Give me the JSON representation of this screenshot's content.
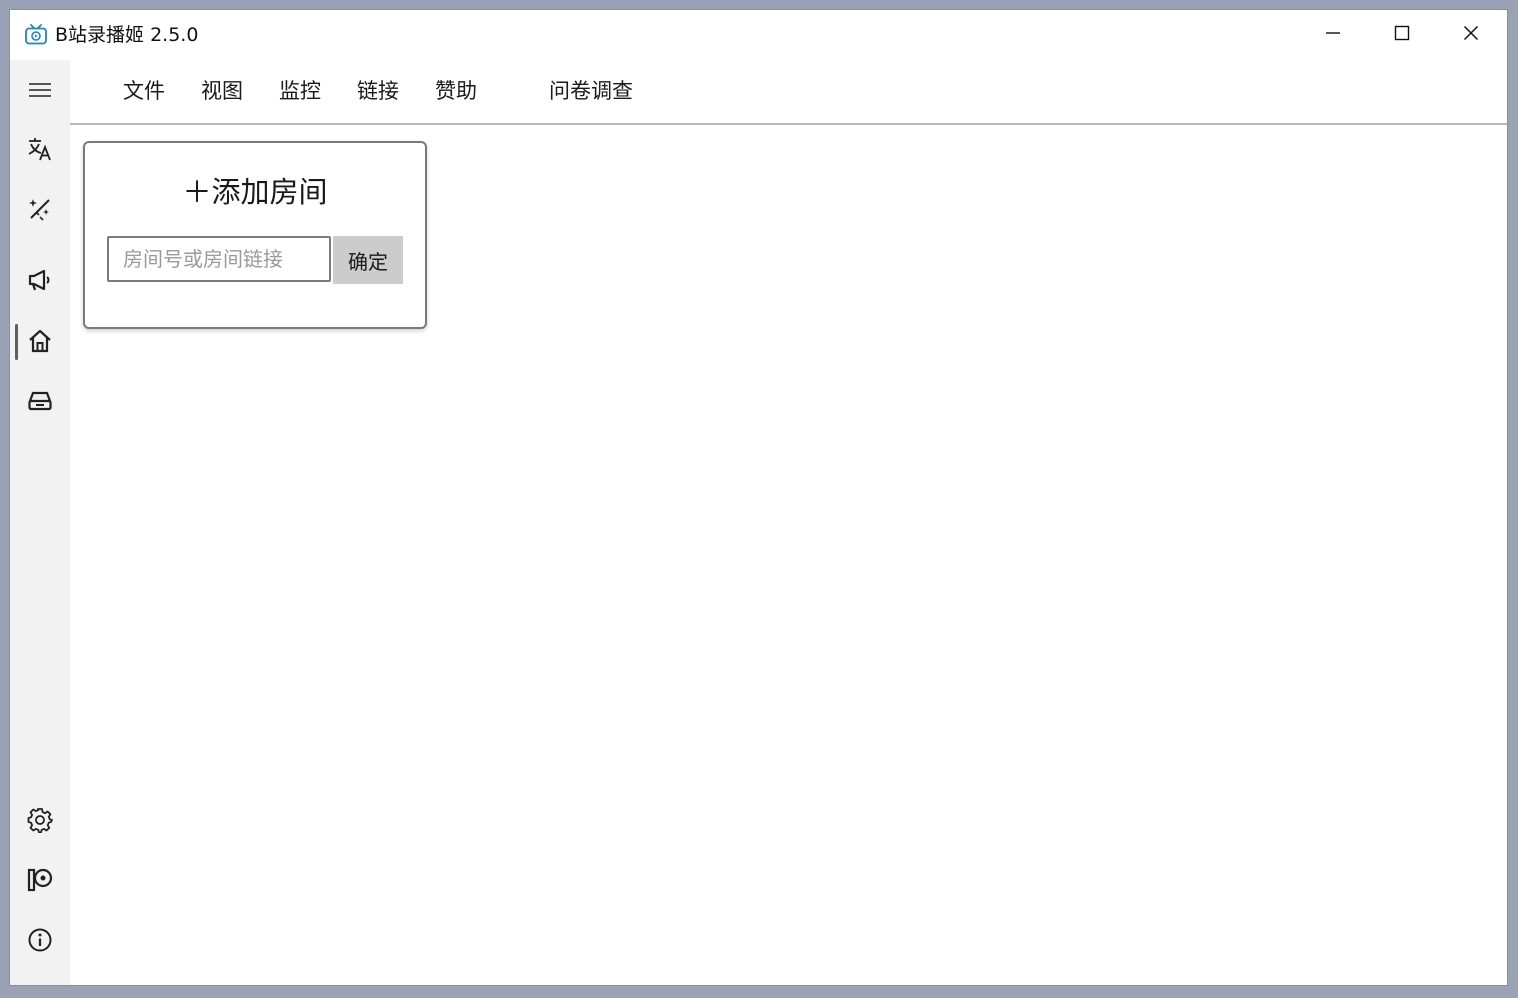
{
  "window": {
    "title": "B站录播姬 2.5.0",
    "controls": {
      "minimize_icon": "minimize-icon",
      "maximize_icon": "maximize-icon",
      "close_icon": "close-icon"
    }
  },
  "nav": {
    "items": [
      {
        "id": "menu",
        "icon": "hamburger-menu-icon"
      },
      {
        "id": "language",
        "icon": "translate-icon"
      },
      {
        "id": "theme",
        "icon": "magic-wand-icon"
      },
      {
        "id": "announcement",
        "icon": "megaphone-icon"
      },
      {
        "id": "home",
        "icon": "home-icon",
        "selected": true
      },
      {
        "id": "toolbox",
        "icon": "toolbox-icon"
      },
      {
        "id": "settings",
        "icon": "gear-icon"
      },
      {
        "id": "sponsor",
        "icon": "patreon-icon"
      },
      {
        "id": "about",
        "icon": "info-icon"
      }
    ]
  },
  "menubar": {
    "items": [
      "文件",
      "视图",
      "监控",
      "链接",
      "赞助",
      "问卷调查"
    ]
  },
  "add_room": {
    "title": "＋添加房间",
    "input_placeholder": "房间号或房间链接",
    "input_value": "",
    "confirm_label": "确定"
  },
  "colors": {
    "nav_background": "#f2f2f2",
    "confirm_button": "#cccccc",
    "app_icon": "#1b87c6"
  }
}
